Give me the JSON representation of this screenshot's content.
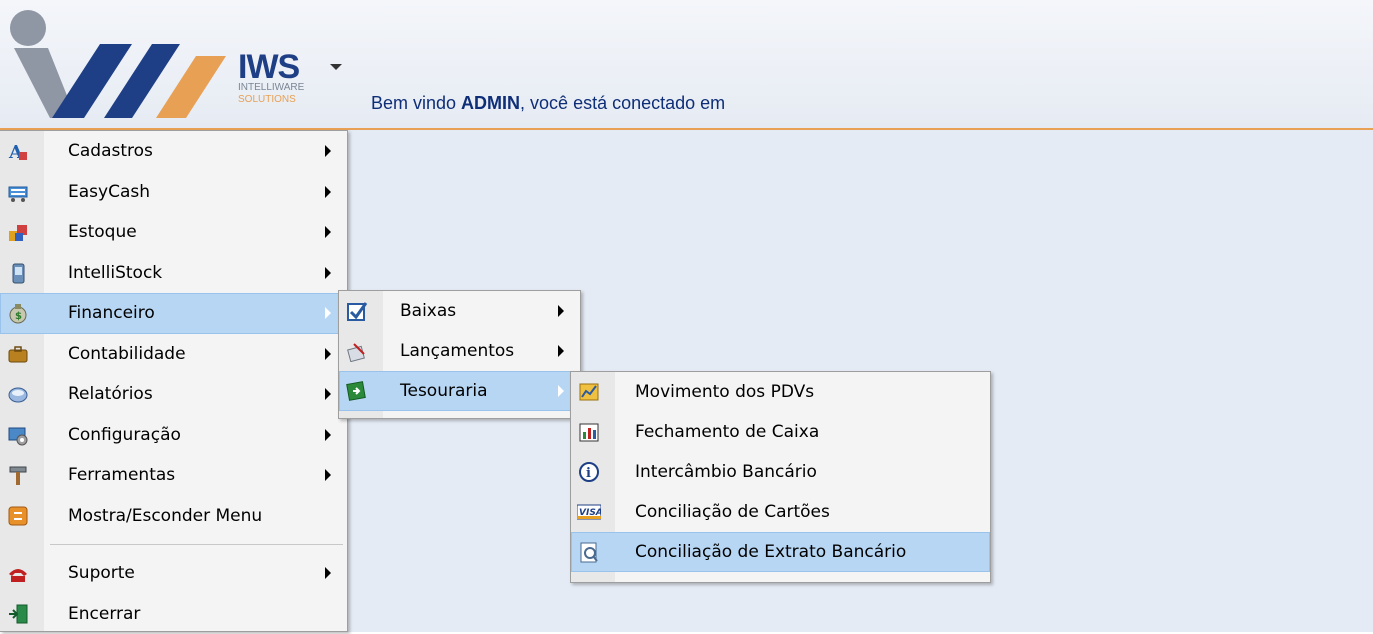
{
  "brand": {
    "name": "IWS",
    "sub1": "INTELLIWARE",
    "sub2": "SOLUTIONS",
    "color_primary": "#1e3f86",
    "color_accent": "#e8a054"
  },
  "welcome": {
    "prefix": "Bem vindo ",
    "user": "ADMIN",
    "suffix": ", você está conectado em"
  },
  "main_menu": {
    "items": [
      {
        "label": "Cadastros",
        "icon": "cadastros-icon",
        "submenu": true
      },
      {
        "label": "EasyCash",
        "icon": "cash-register-icon",
        "submenu": true
      },
      {
        "label": "Estoque",
        "icon": "boxes-icon",
        "submenu": true
      },
      {
        "label": "IntelliStock",
        "icon": "handheld-icon",
        "submenu": true
      },
      {
        "label": "Financeiro",
        "icon": "money-bag-icon",
        "submenu": true,
        "active": true
      },
      {
        "label": "Contabilidade",
        "icon": "briefcase-icon",
        "submenu": true
      },
      {
        "label": "Relatórios",
        "icon": "reports-icon",
        "submenu": true
      },
      {
        "label": "Configuração",
        "icon": "settings-icon",
        "submenu": true
      },
      {
        "label": "Ferramentas",
        "icon": "hammer-icon",
        "submenu": true
      },
      {
        "label": "Mostra/Esconder Menu",
        "icon": "toggle-menu-icon",
        "submenu": false
      },
      {
        "label": "Suporte",
        "icon": "phone-icon",
        "submenu": true
      },
      {
        "label": "Encerrar",
        "icon": "exit-icon",
        "submenu": false
      }
    ]
  },
  "financeiro_menu": {
    "items": [
      {
        "label": "Baixas",
        "icon": "checkbox-icon"
      },
      {
        "label": "Lançamentos",
        "icon": "entries-icon"
      },
      {
        "label": "Tesouraria",
        "icon": "treasury-icon",
        "active": true
      }
    ]
  },
  "tesouraria_menu": {
    "items": [
      {
        "label": "Movimento dos PDVs",
        "icon": "pos-movement-icon"
      },
      {
        "label": "Fechamento de Caixa",
        "icon": "cash-closing-icon"
      },
      {
        "label": "Intercâmbio Bancário",
        "icon": "info-icon"
      },
      {
        "label": "Conciliação de Cartões",
        "icon": "visa-card-icon"
      },
      {
        "label": "Conciliação de Extrato Bancário",
        "icon": "bank-statement-icon",
        "active": true
      }
    ]
  }
}
